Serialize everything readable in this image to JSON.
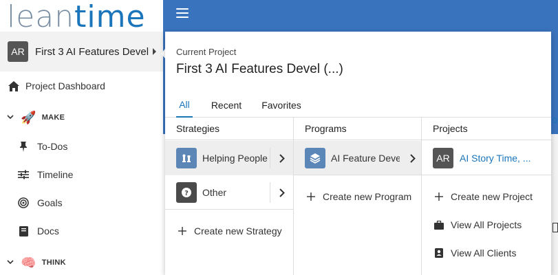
{
  "logo": {
    "part1": "lean",
    "part2": "time"
  },
  "sidebar": {
    "project_avatar": "AR",
    "project_name": "First 3 AI Features Devel",
    "dashboard": "Project Dashboard",
    "sections": [
      {
        "label": "MAKE",
        "emoji": "🚀"
      },
      {
        "label": "THINK",
        "emoji": "🧠"
      }
    ],
    "make_items": [
      "To-Dos",
      "Timeline",
      "Goals",
      "Docs"
    ]
  },
  "panel": {
    "current_label": "Current Project",
    "current_name": "First 3 AI Features Devel (...)",
    "tabs": [
      "All",
      "Recent",
      "Favorites"
    ],
    "strategies": {
      "header": "Strategies",
      "items": [
        "Helping People",
        "Other"
      ],
      "create": "Create new Strategy"
    },
    "programs": {
      "header": "Programs",
      "items": [
        "AI Feature Deve..."
      ],
      "create": "Create new Program"
    },
    "projects": {
      "header": "Projects",
      "avatar": "AR",
      "items": [
        "AI Story Time, ..."
      ],
      "create": "Create new Project",
      "view_all": "View All Projects",
      "view_clients": "View All Clients"
    },
    "other_icon_glyph": "?"
  },
  "right_edge_glyph": "o",
  "colors": {
    "header_blue": "#3a73bd",
    "accent": "#1b75bb",
    "logo_gray": "#7a8ea3",
    "avatar_gray": "#555555"
  }
}
